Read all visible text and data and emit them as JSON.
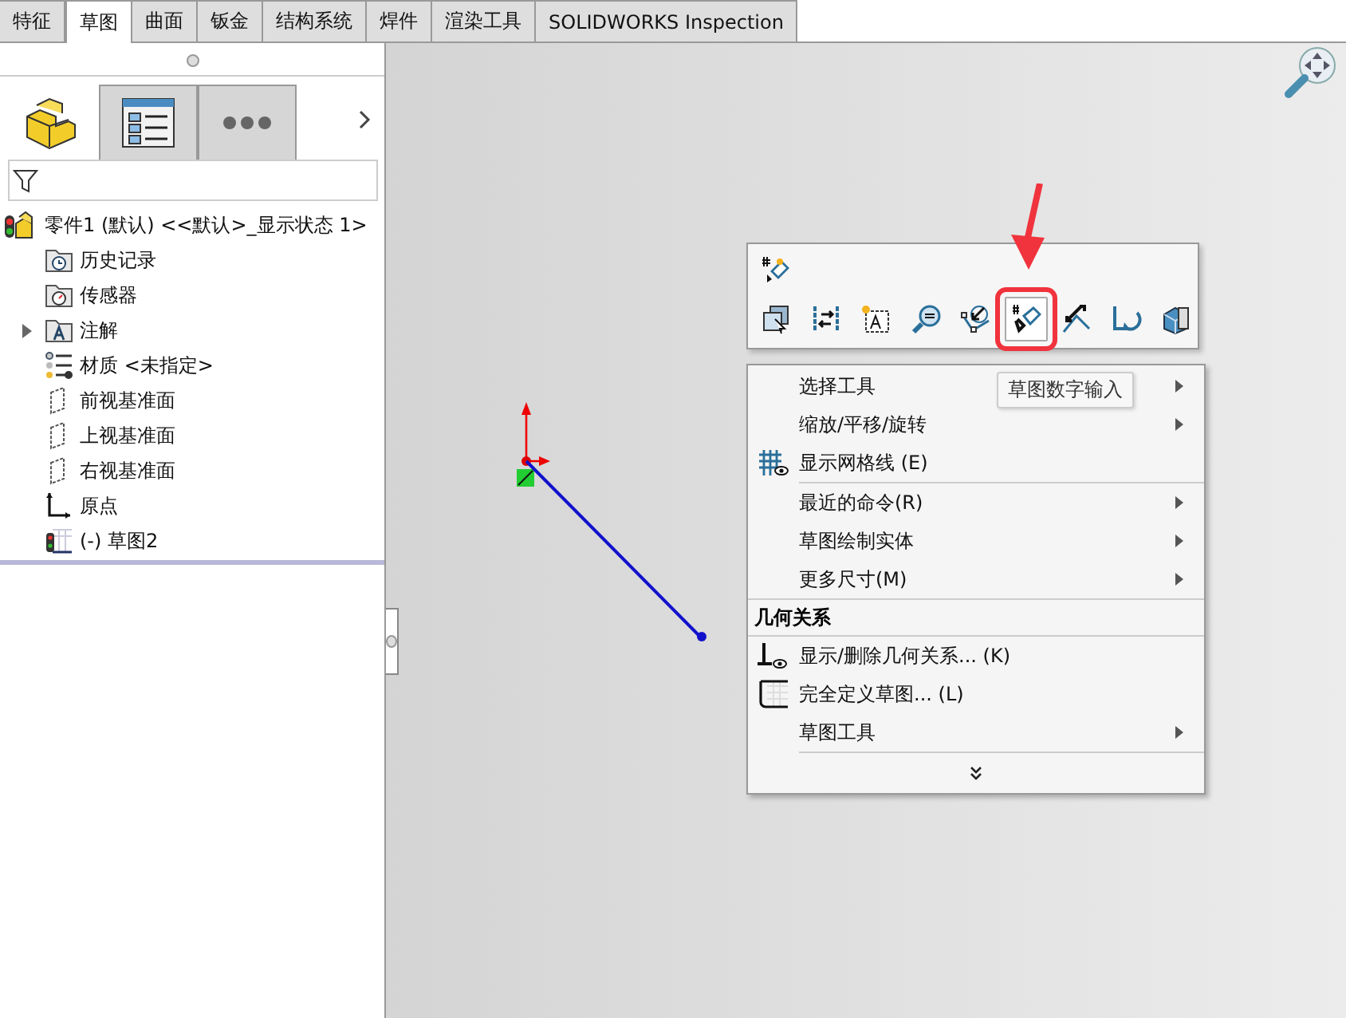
{
  "tabs": [
    {
      "label": "特征",
      "selected": false
    },
    {
      "label": "草图",
      "selected": true
    },
    {
      "label": "曲面",
      "selected": false
    },
    {
      "label": "钣金",
      "selected": false
    },
    {
      "label": "结构系统",
      "selected": false
    },
    {
      "label": "焊件",
      "selected": false
    },
    {
      "label": "渲染工具",
      "selected": false
    },
    {
      "label": "SOLIDWORKS Inspection",
      "selected": false
    }
  ],
  "panel_tabs": [
    {
      "kind": "part",
      "selected": true
    },
    {
      "kind": "properties",
      "selected": false
    },
    {
      "kind": "more",
      "selected": false
    }
  ],
  "tree": {
    "label": "零件1 (默认) <<默认>_显示状态 1>",
    "children": [
      {
        "kind": "history",
        "label": "历史记录",
        "expandable": false
      },
      {
        "kind": "sensor",
        "label": "传感器",
        "expandable": false
      },
      {
        "kind": "annotation",
        "label": "注解",
        "expandable": true
      },
      {
        "kind": "material",
        "label": "材质 <未指定>",
        "expandable": false
      },
      {
        "kind": "plane",
        "label": "前视基准面",
        "expandable": false
      },
      {
        "kind": "plane",
        "label": "上视基准面",
        "expandable": false
      },
      {
        "kind": "plane",
        "label": "右视基准面",
        "expandable": false
      },
      {
        "kind": "origin",
        "label": "原点",
        "expandable": false
      },
      {
        "kind": "sketch",
        "label": "(-) 草图2",
        "expandable": false
      }
    ]
  },
  "context_toolbar": {
    "buttons": [
      {
        "kind": "select",
        "highlighted": false
      },
      {
        "kind": "swap",
        "highlighted": false
      },
      {
        "kind": "text",
        "highlighted": false
      },
      {
        "kind": "zoom",
        "highlighted": false
      },
      {
        "kind": "normal",
        "highlighted": false
      },
      {
        "kind": "numeric",
        "highlighted": true
      },
      {
        "kind": "dimension",
        "highlighted": false
      },
      {
        "kind": "undo",
        "highlighted": false
      },
      {
        "kind": "view",
        "highlighted": false
      }
    ],
    "tooltip": "草图数字输入"
  },
  "menu": {
    "sections": [
      {
        "items": [
          {
            "label": "选择工具",
            "kind": "plain",
            "submenu": true
          },
          {
            "label": "缩放/平移/旋转",
            "kind": "plain",
            "submenu": true
          },
          {
            "label": "显示网格线 (E)",
            "kind": "grid",
            "submenu": false
          }
        ]
      },
      {
        "items": [
          {
            "label": "最近的命令(R)",
            "kind": "plain",
            "submenu": true
          },
          {
            "label": "草图绘制实体",
            "kind": "plain",
            "submenu": true
          },
          {
            "label": "更多尺寸(M)",
            "kind": "plain",
            "submenu": true
          }
        ]
      },
      {
        "header": "几何关系",
        "items": [
          {
            "label": "显示/删除几何关系... (K)",
            "kind": "relation",
            "submenu": false
          },
          {
            "label": "完全定义草图... (L)",
            "kind": "define",
            "submenu": false
          },
          {
            "label": "草图工具",
            "kind": "plain",
            "submenu": true
          }
        ]
      }
    ]
  }
}
